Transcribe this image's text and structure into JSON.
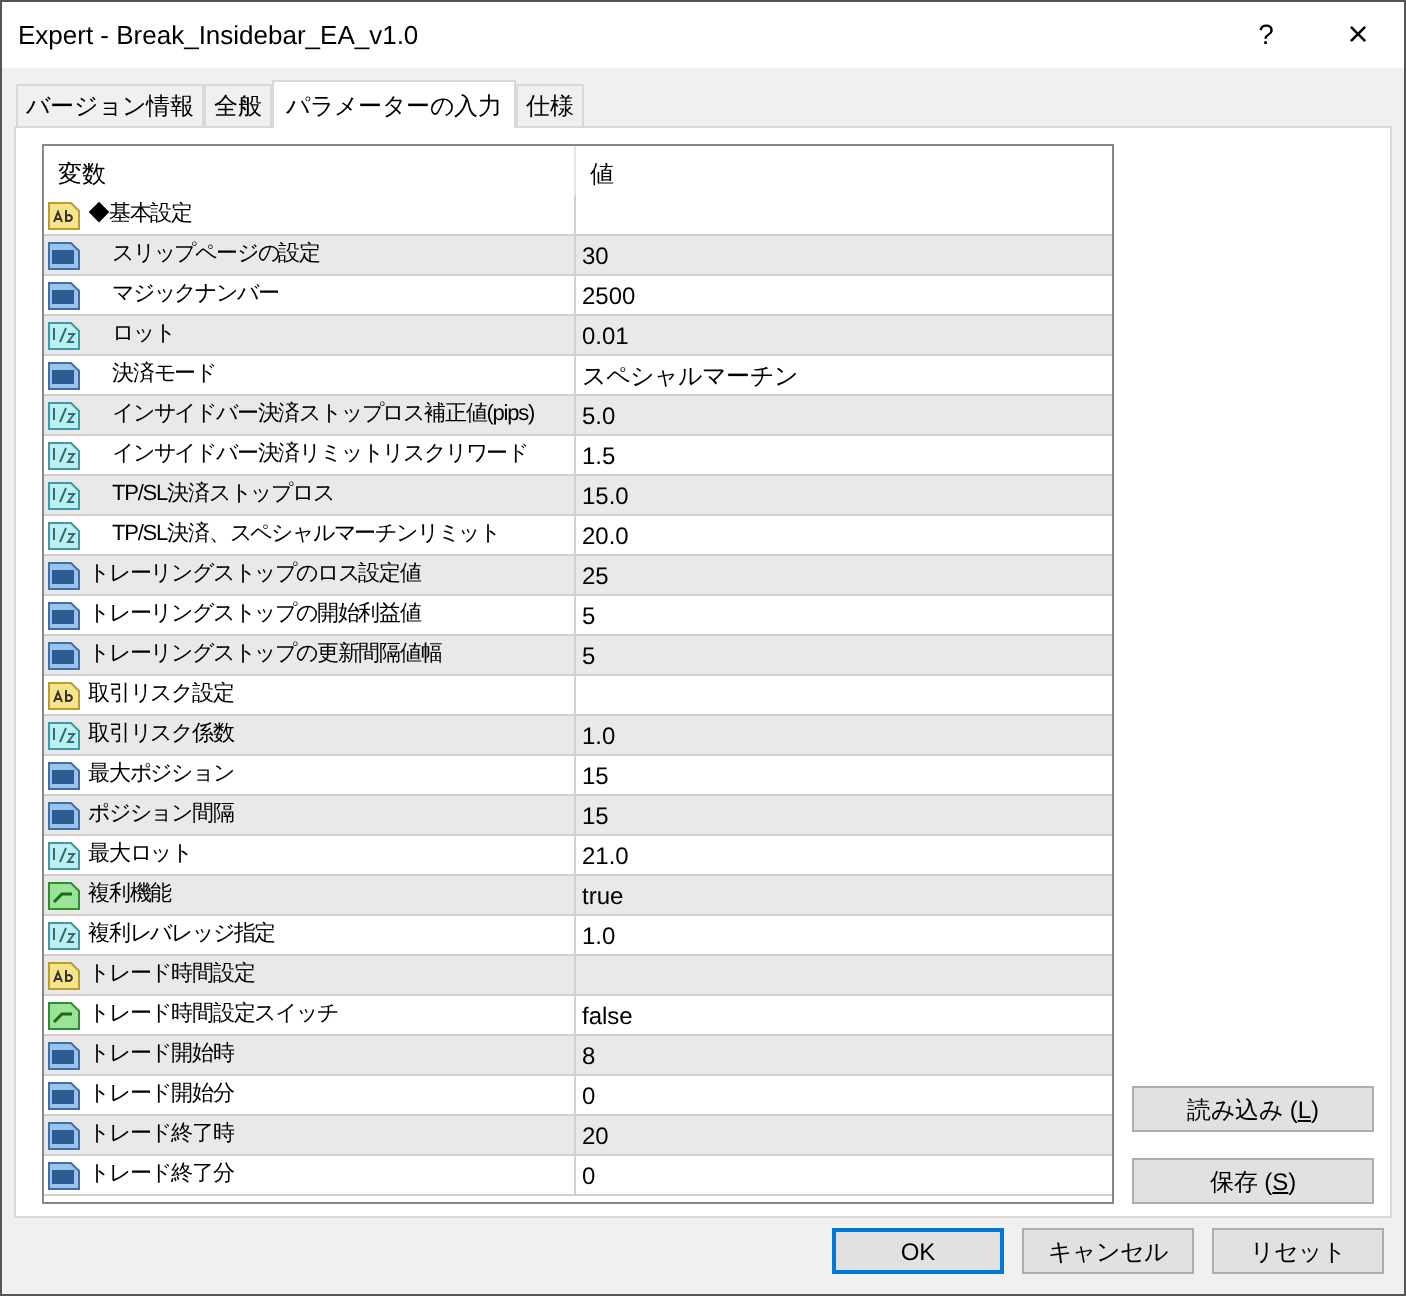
{
  "window": {
    "title": "Expert - Break_Insidebar_EA_v1.0",
    "help": "?",
    "close": "×"
  },
  "tabs": [
    {
      "label": "バージョン情報",
      "selected": false
    },
    {
      "label": "全般",
      "selected": false
    },
    {
      "label": "パラメーターの入力",
      "selected": true
    },
    {
      "label": "仕様",
      "selected": false
    }
  ],
  "table": {
    "columns": [
      "変数",
      "値"
    ],
    "rows": [
      {
        "kind": "text",
        "name": "◆基本設定",
        "children": [
          {
            "kind": "int",
            "name": "スリップページの設定",
            "value": "30"
          },
          {
            "kind": "int",
            "name": "マジックナンバー",
            "value": "2500"
          },
          {
            "kind": "double",
            "name": "ロット",
            "value": "0.01"
          },
          {
            "kind": "int",
            "name": "決済モード",
            "value": "スペシャルマーチン"
          },
          {
            "kind": "double",
            "name": "インサイドバー決済ストップロス補正値(pips)",
            "value": "5.0"
          },
          {
            "kind": "double",
            "name": "インサイドバー決済リミットリスクリワード",
            "value": "1.5"
          },
          {
            "kind": "double",
            "name": "TP/SL決済ストップロス",
            "value": "15.0"
          },
          {
            "kind": "double",
            "name": "TP/SL決済、スペシャルマーチンリミット",
            "value": "20.0"
          }
        ]
      },
      {
        "kind": "int",
        "name": "トレーリングストップのロス設定値",
        "value": "25"
      },
      {
        "kind": "int",
        "name": "トレーリングストップの開始利益値",
        "value": "5"
      },
      {
        "kind": "int",
        "name": "トレーリングストップの更新間隔値幅",
        "value": "5"
      },
      {
        "kind": "text",
        "name": "取引リスク設定"
      },
      {
        "kind": "double",
        "name": "取引リスク係数",
        "value": "1.0"
      },
      {
        "kind": "int",
        "name": "最大ポジション",
        "value": "15"
      },
      {
        "kind": "int",
        "name": "ポジション間隔",
        "value": "15"
      },
      {
        "kind": "double",
        "name": "最大ロット",
        "value": "21.0"
      },
      {
        "kind": "bool",
        "name": "複利機能",
        "value": "true"
      },
      {
        "kind": "double",
        "name": "複利レバレッジ指定",
        "value": "1.0"
      },
      {
        "kind": "text",
        "name": "トレード時間設定"
      },
      {
        "kind": "bool",
        "name": "トレード時間設定スイッチ",
        "value": "false"
      },
      {
        "kind": "int",
        "name": "トレード開始時",
        "value": "8"
      },
      {
        "kind": "int",
        "name": "トレード開始分",
        "value": "0"
      },
      {
        "kind": "int",
        "name": "トレード終了時",
        "value": "20"
      },
      {
        "kind": "int",
        "name": "トレード終了分",
        "value": "0"
      }
    ]
  },
  "side_buttons": [
    {
      "label": "読み込み (",
      "key": "L",
      "end": ")"
    },
    {
      "label": "保存 (",
      "key": "S",
      "end": ")"
    }
  ],
  "buttons": [
    {
      "label": "OK",
      "default": true
    },
    {
      "label": "キャンセル",
      "default": false
    },
    {
      "label": "リセット",
      "default": false
    }
  ]
}
